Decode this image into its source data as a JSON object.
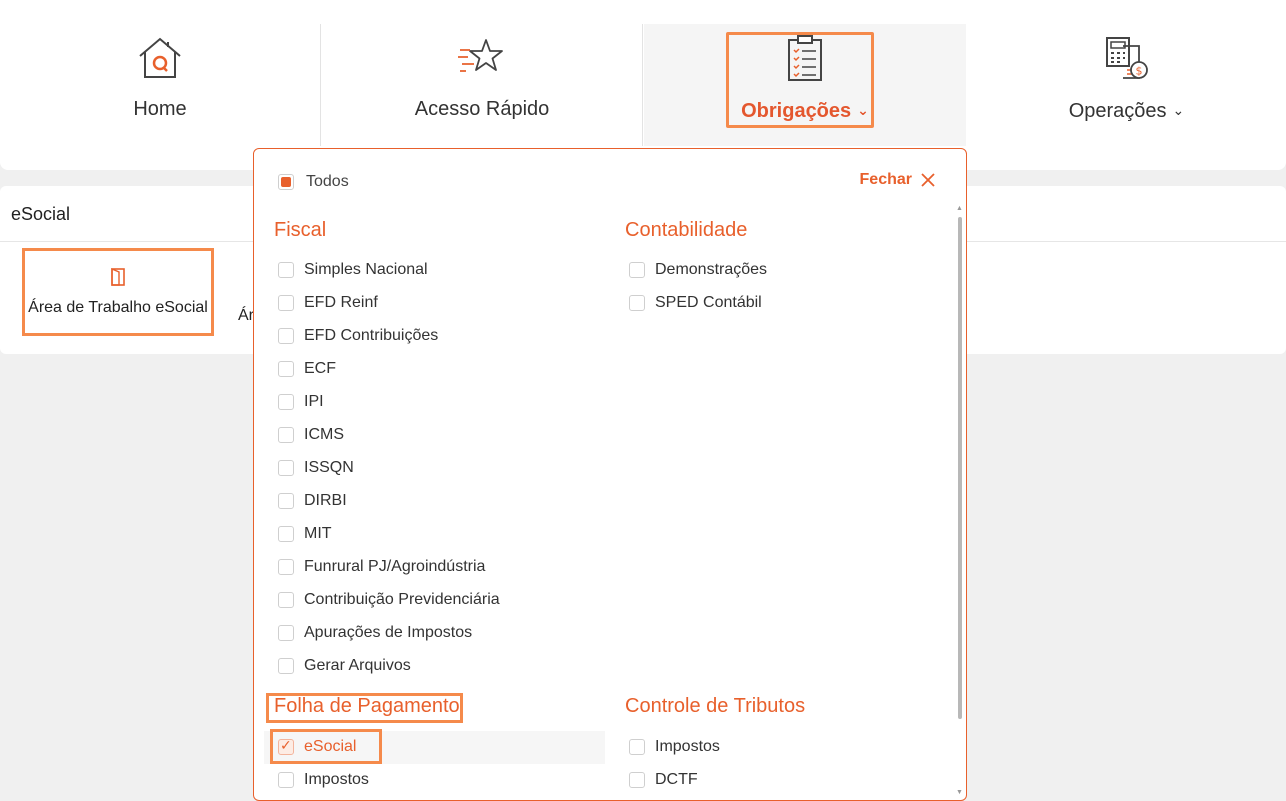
{
  "nav": {
    "home": "Home",
    "quick": "Acesso Rápido",
    "obrigacoes": "Obrigações",
    "operacoes": "Operações",
    "chevron": "⌄"
  },
  "panel": {
    "title": "eSocial",
    "card_label": "Área de Trabalho eSocial",
    "card2_label_partial": "Ár"
  },
  "dropdown": {
    "todos": "Todos",
    "fechar": "Fechar",
    "fiscal": {
      "title": "Fiscal",
      "items": [
        "Simples Nacional",
        "EFD Reinf",
        "EFD Contribuições",
        "ECF",
        "IPI",
        "ICMS",
        "ISSQN",
        "DIRBI",
        "MIT",
        "Funrural PJ/Agroindústria",
        "Contribuição Previdenciária",
        "Apurações de Impostos",
        "Gerar Arquivos"
      ]
    },
    "contabilidade": {
      "title": "Contabilidade",
      "items": [
        "Demonstrações",
        "SPED Contábil"
      ]
    },
    "folha": {
      "title": "Folha de Pagamento",
      "items": [
        "eSocial",
        "Impostos"
      ],
      "checked": "eSocial"
    },
    "controle": {
      "title": "Controle de Tributos",
      "items": [
        "Impostos",
        "DCTF"
      ]
    }
  },
  "colors": {
    "accent": "#e8602c",
    "highlight": "#f58a4b"
  },
  "icons": [
    "home-icon",
    "star-icon",
    "clipboard-icon",
    "calculator-money-icon",
    "door-icon",
    "close-icon",
    "chevron-down-icon"
  ]
}
